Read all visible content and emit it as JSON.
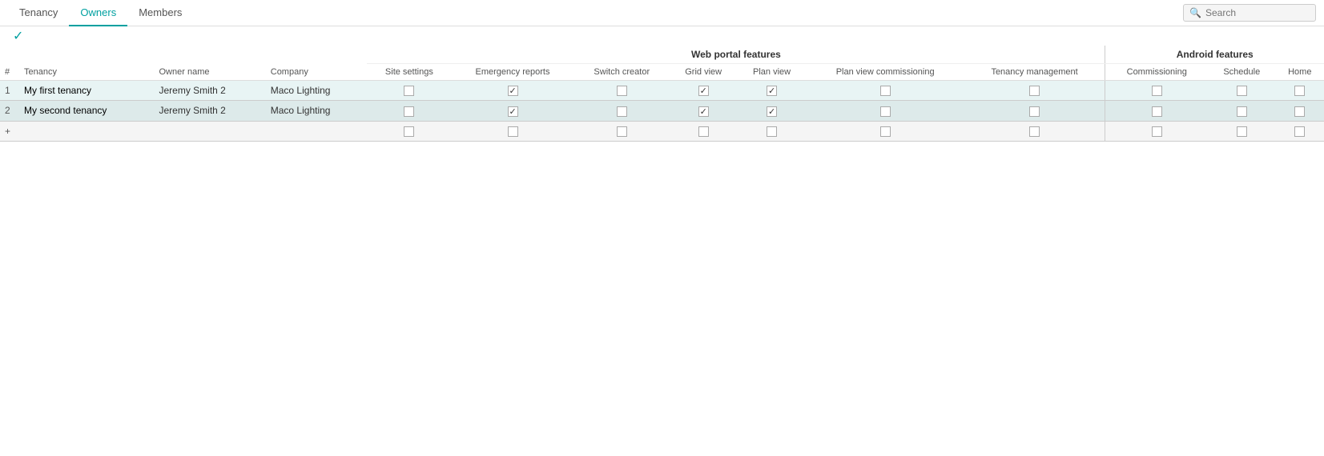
{
  "nav": {
    "tabs": [
      {
        "id": "tenancy",
        "label": "Tenancy",
        "active": false
      },
      {
        "id": "owners",
        "label": "Owners",
        "active": true
      },
      {
        "id": "members",
        "label": "Members",
        "active": false
      }
    ],
    "search_placeholder": "Search"
  },
  "save_icon": "✓",
  "table": {
    "group_headers": {
      "web_portal": "Web portal features",
      "android": "Android features"
    },
    "columns": [
      {
        "id": "num",
        "label": "#",
        "group": "meta"
      },
      {
        "id": "tenancy",
        "label": "Tenancy",
        "group": "meta"
      },
      {
        "id": "owner_name",
        "label": "Owner name",
        "group": "meta"
      },
      {
        "id": "company",
        "label": "Company",
        "group": "meta"
      },
      {
        "id": "site_settings",
        "label": "Site settings",
        "group": "web"
      },
      {
        "id": "emergency_reports",
        "label": "Emergency reports",
        "group": "web"
      },
      {
        "id": "switch_creator",
        "label": "Switch creator",
        "group": "web"
      },
      {
        "id": "grid_view",
        "label": "Grid view",
        "group": "web"
      },
      {
        "id": "plan_view",
        "label": "Plan view",
        "group": "web"
      },
      {
        "id": "plan_view_commissioning",
        "label": "Plan view commissioning",
        "group": "web"
      },
      {
        "id": "tenancy_management",
        "label": "Tenancy management",
        "group": "web"
      },
      {
        "id": "commissioning",
        "label": "Commissioning",
        "group": "android"
      },
      {
        "id": "schedule",
        "label": "Schedule",
        "group": "android"
      },
      {
        "id": "home",
        "label": "Home",
        "group": "android"
      }
    ],
    "rows": [
      {
        "num": "1",
        "tenancy": "My first tenancy",
        "owner_name": "Jeremy Smith 2",
        "company": "Maco Lighting",
        "site_settings": false,
        "emergency_reports": true,
        "switch_creator": false,
        "grid_view": true,
        "plan_view": true,
        "plan_view_commissioning": false,
        "tenancy_management": false,
        "commissioning": false,
        "schedule": false,
        "home": false
      },
      {
        "num": "2",
        "tenancy": "My second tenancy",
        "owner_name": "Jeremy Smith 2",
        "company": "Maco Lighting",
        "site_settings": false,
        "emergency_reports": true,
        "switch_creator": false,
        "grid_view": true,
        "plan_view": true,
        "plan_view_commissioning": false,
        "tenancy_management": false,
        "commissioning": false,
        "schedule": false,
        "home": false
      }
    ],
    "new_row_label": "+"
  }
}
